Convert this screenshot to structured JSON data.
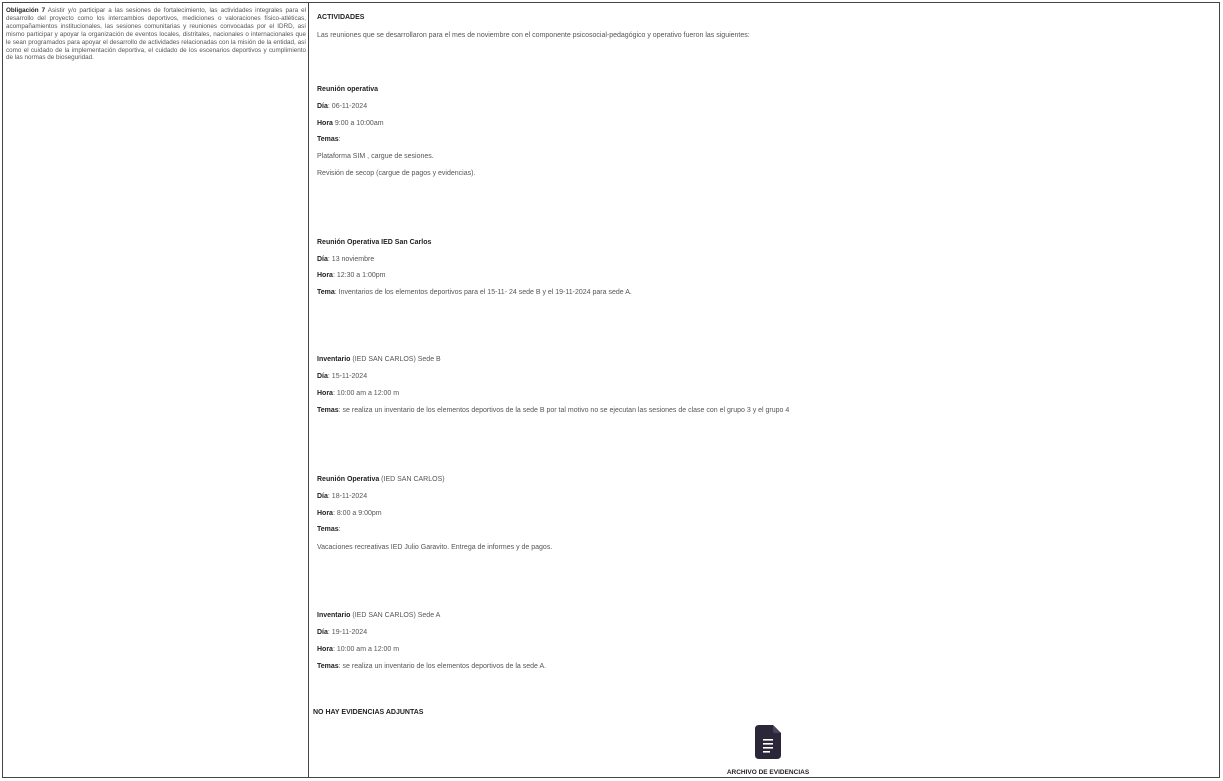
{
  "obligation": {
    "label": "Obligación 7",
    "text": "Asistir y/o participar a las sesiones de fortalecimiento, las actividades integrales para el desarrollo del proyecto como los intercambios deportivos, mediciones o valoraciones físico-atléticas, acompañamientos institucionales, las sesiones comunitarias y reuniones convocadas por el IDRD, así mismo participar y apoyar la organización de eventos locales, distritales, nacionales o internacionales que le sean programados para apoyar el desarrollo de actividades relacionadas con la misión de la entidad, así como el cuidado de la implementación deportiva, el cuidado de los escenarios deportivos y cumplimiento de las normas de bioseguridad."
  },
  "activities": {
    "heading": "ACTIVIDADES",
    "intro": "Las reuniones que se desarrollaron para el mes de noviembre con el componente psicosocial-pedagógico y operativo fueron las siguientes:",
    "meetings": [
      {
        "title": "Reunión operativa",
        "day_label": "Día",
        "day": ": 06-11-2024",
        "hour_label": "Hora",
        "hour": " 9:00 a 10:00am",
        "topics_label": "Temas",
        "topics": ":",
        "lines": [
          "Plataforma SIM , cargue de sesiones.",
          "Revisión de secop (cargue de pagos y evidencias)."
        ]
      },
      {
        "title": "Reunión Operativa IED San Carlos",
        "day_label": "Día",
        "day": ": 13 noviembre",
        "hour_label": "Hora",
        "hour": ": 12:30 a 1:00pm",
        "topics_label": "Tema",
        "topics": ": Inventarios de los elementos deportivos para el 15-11- 24 sede B y el 19-11-2024 para sede A."
      },
      {
        "title": "Inventario",
        "title_suffix": " (IED SAN CARLOS) Sede B",
        "day_label": "Día",
        "day": ": 15-11-2024",
        "hour_label": "Hora",
        "hour": ": 10:00 am a 12:00 m",
        "topics_label": "Temas",
        "topics": ": se realiza un inventario de los elementos deportivos de la sede B por tal motivo no se ejecutan las sesiones de clase con el grupo 3 y el grupo 4"
      },
      {
        "title": "Reunión Operativa",
        "title_suffix": " (IED SAN CARLOS)",
        "day_label": "Día",
        "day": ": 18-11-2024",
        "hour_label": "Hora",
        "hour": ": 8:00 a 9:00pm",
        "topics_label": "Temas",
        "topics": ":",
        "lines": [
          "Vacaciones recreativas IED Julio Garavito. Entrega de informes y de pagos."
        ]
      },
      {
        "title": "Inventario",
        "title_suffix": " (IED SAN CARLOS) Sede A",
        "day_label": " Día",
        "day": ": 19-11-2024",
        "hour_label": "Hora",
        "hour": ": 10:00 am a 12:00 m",
        "topics_label": "Temas",
        "topics": ": se realiza un inventario de los elementos deportivos de la sede A."
      }
    ],
    "no_evidence": "NO HAY EVIDENCIAS ADJUNTAS",
    "evidence_file_label": "ARCHIVO DE EVIDENCIAS",
    "file_icon": "file-document-icon",
    "file_icon_color": "#2b2638"
  }
}
